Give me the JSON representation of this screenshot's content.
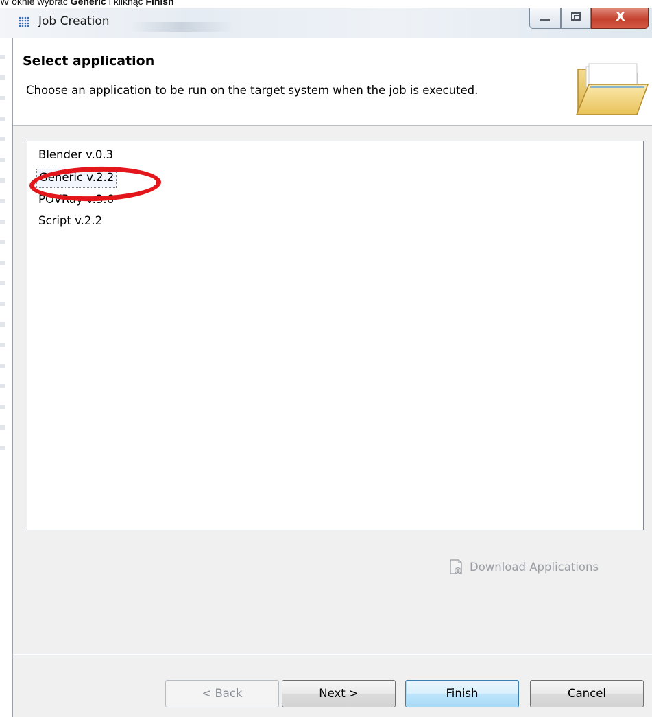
{
  "caption": {
    "prefix": "W oknie wybrać ",
    "bold1": "Generic",
    "middle": " i kliknąć ",
    "bold2": "Finish"
  },
  "window": {
    "title": "Job Creation",
    "app_icon": "grid-dots-icon",
    "controls": {
      "minimize_icon": "minimize-icon",
      "maximize_icon": "maximize-icon",
      "close_label": "X"
    }
  },
  "header": {
    "title": "Select application",
    "description": "Choose an application to be run on the target system when the job is executed.",
    "icon": "open-folder-icon"
  },
  "applications": {
    "items": [
      {
        "label": "Blender v.0.3",
        "selected": false
      },
      {
        "label": "Generic v.2.2",
        "selected": true
      },
      {
        "label": "POVRay v.3.6",
        "selected": false
      },
      {
        "label": "Script v.2.2",
        "selected": false
      }
    ]
  },
  "download": {
    "label": "Download Applications",
    "icon": "download-document-icon",
    "enabled": false
  },
  "buttons": {
    "back": "< Back",
    "next": "Next >",
    "finish": "Finish",
    "cancel": "Cancel"
  },
  "annotation": {
    "color": "#e3161b",
    "target": "Generic v.2.2"
  }
}
